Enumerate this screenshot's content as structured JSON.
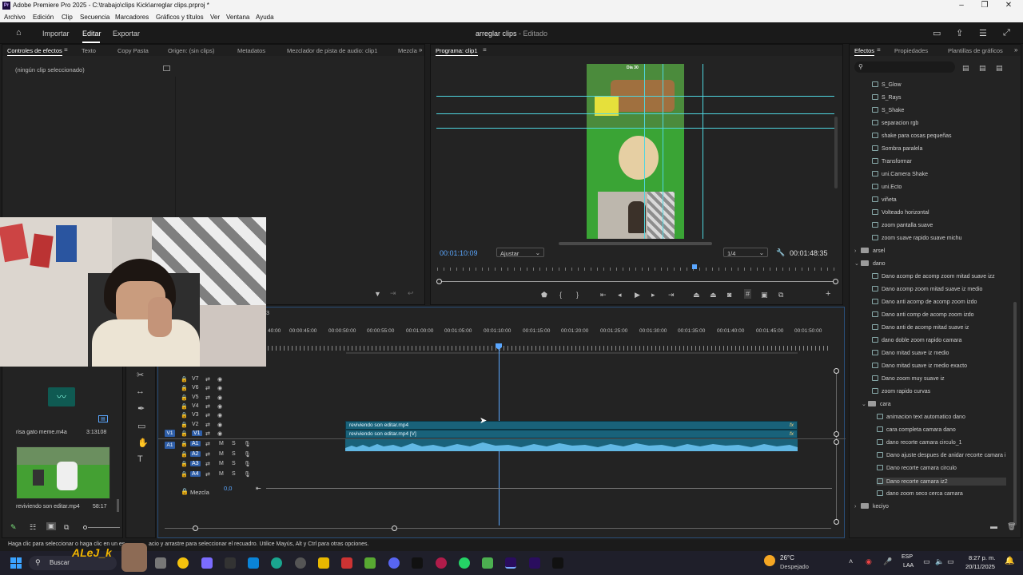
{
  "window": {
    "app_icon": "Pr",
    "title": "Adobe Premiere Pro 2025 - C:\\trabajo\\clips Kick\\arreglar clips.prproj *"
  },
  "menu": [
    "Archivo",
    "Edición",
    "Clip",
    "Secuencia",
    "Marcadores",
    "Gráficos y títulos",
    "Ver",
    "Ventana",
    "Ayuda"
  ],
  "header": {
    "workspaces": [
      "Importar",
      "Editar",
      "Exportar"
    ],
    "active_workspace": "Editar",
    "project_title": "arreglar clips",
    "project_state": "- Editado"
  },
  "source_panel": {
    "tabs": [
      "Controles de efectos",
      "Texto",
      "Copy Pasta",
      "Origen: (sin clips)",
      "Metadatos",
      "Mezclador de pista de audio: clip1",
      "Mezcla"
    ],
    "empty_message": "(ningún clip seleccionado)"
  },
  "program_monitor": {
    "title": "Programa: clip1",
    "timecode": "00:01:10:09",
    "fit": "Ajustar",
    "resolution": "1/4",
    "duration": "00:01:48:35",
    "overlay_text": "Día 30"
  },
  "project_bin": {
    "items": [
      {
        "name": "risa gato meme.m4a",
        "duration": "3:13108"
      },
      {
        "name": "reviviendo son editar.mp4",
        "duration": "58:17"
      }
    ]
  },
  "timeline": {
    "ruler": [
      "40:00",
      "00:00:45:00",
      "00:00:50:00",
      "00:00:55:00",
      "00:01:00:00",
      "00:01:05:00",
      "00:01:10:00",
      "00:01:15:00",
      "00:01:20:00",
      "00:01:25:00",
      "00:01:30:00",
      "00:01:35:00",
      "00:01:40:00",
      "00:01:45:00",
      "00:01:50:00"
    ],
    "ruler_prefix": "3",
    "video_tracks": [
      "V7",
      "V6",
      "V5",
      "V4",
      "V3",
      "V2",
      "V1"
    ],
    "audio_tracks": [
      "A1",
      "A2",
      "A3",
      "A4"
    ],
    "mix_label": "Mezcla",
    "mix_value": "0,0",
    "clip_audio_name": "reviviendo son editar.mp4",
    "clip_video_name": "reviviendo son editar.mp4 [V]",
    "fx_label": "fx",
    "source_patch_v": "V1",
    "source_patch_a": "A1",
    "track_toggles": {
      "mute": "M",
      "solo": "S"
    }
  },
  "effects_panel": {
    "tabs": [
      "Efectos",
      "Propiedades",
      "Plantillas de gráficos"
    ],
    "items": [
      {
        "type": "preset",
        "label": "S_Glow",
        "indent": 1
      },
      {
        "type": "preset",
        "label": "S_Rays",
        "indent": 1
      },
      {
        "type": "preset",
        "label": "S_Shake",
        "indent": 1
      },
      {
        "type": "preset",
        "label": "separacion rgb",
        "indent": 1
      },
      {
        "type": "preset",
        "label": "shake para cosas pequeñas",
        "indent": 1
      },
      {
        "type": "preset",
        "label": "Sombra paralela",
        "indent": 1
      },
      {
        "type": "preset",
        "label": "Transformar",
        "indent": 1
      },
      {
        "type": "preset",
        "label": "uni.Camera Shake",
        "indent": 1
      },
      {
        "type": "preset",
        "label": "uni.Ecto",
        "indent": 1
      },
      {
        "type": "preset",
        "label": "viñeta",
        "indent": 1
      },
      {
        "type": "preset",
        "label": "Volteado horizontal",
        "indent": 1
      },
      {
        "type": "preset",
        "label": "zoom pantalla suave",
        "indent": 1
      },
      {
        "type": "preset",
        "label": "zoom suave rapido suave michu",
        "indent": 1
      },
      {
        "type": "folder",
        "label": "arsel",
        "indent": 0,
        "open": false
      },
      {
        "type": "folder",
        "label": "dano",
        "indent": 0,
        "open": true
      },
      {
        "type": "preset",
        "label": "Dano acomp de acomp zoom mitad suave izz",
        "indent": 1
      },
      {
        "type": "preset",
        "label": "Dano acomp zoom mitad suave iz medio",
        "indent": 1
      },
      {
        "type": "preset",
        "label": "Dano anti acomp de acomp zoom izdo",
        "indent": 1
      },
      {
        "type": "preset",
        "label": "Dano anti comp de acomp zoom izdo",
        "indent": 1
      },
      {
        "type": "preset",
        "label": "Dano anti de acomp mitad suave iz",
        "indent": 1
      },
      {
        "type": "preset",
        "label": "dano doble zoom rapido camara",
        "indent": 1
      },
      {
        "type": "preset",
        "label": "Dano mitad suave iz medio",
        "indent": 1
      },
      {
        "type": "preset",
        "label": "Dano mitad suave iz medio exacto",
        "indent": 1
      },
      {
        "type": "preset",
        "label": "Dano zoom muy suave iz",
        "indent": 1
      },
      {
        "type": "preset",
        "label": "zoom rapido curvas",
        "indent": 1
      },
      {
        "type": "folder",
        "label": "cara",
        "indent": 1,
        "open": true
      },
      {
        "type": "preset",
        "label": "animacion text automatico dano",
        "indent": 2
      },
      {
        "type": "preset",
        "label": "cara completa camara dano",
        "indent": 2
      },
      {
        "type": "preset",
        "label": "dano recorte camara circulo_1",
        "indent": 2
      },
      {
        "type": "preset",
        "label": "Dano ajuste despues de anidar recorte camara i",
        "indent": 2
      },
      {
        "type": "preset",
        "label": "Dano recorte  camara circulo",
        "indent": 2
      },
      {
        "type": "preset",
        "label": "Dano recorte camara iz2",
        "indent": 2,
        "selected": true
      },
      {
        "type": "preset",
        "label": "dano zoom seco cerca camara",
        "indent": 2
      },
      {
        "type": "folder",
        "label": "keciyo",
        "indent": 0,
        "open": false
      }
    ]
  },
  "status": {
    "hint_text": "Haga clic para seleccionar o haga clic en un es",
    "hint_text_2": "acio y arrastre para seleccionar el recuadro. Utilice Mayús, Alt y Ctrl para otras opciones.",
    "overlay_name": "ALeJ_k"
  },
  "taskbar": {
    "search": "Buscar",
    "weather_temp": "26°C",
    "weather_desc": "Despejado",
    "lang": "ESP",
    "lang2": "LAA",
    "time": "8:27 p. m.",
    "date": "20/11/2025"
  },
  "colors": {
    "accent_blue": "#2e5ea8",
    "clip_teal": "#19627a",
    "waveform": "#61b8e4",
    "guides": "#4fd6e0",
    "playhead": "#5aa7ff"
  }
}
